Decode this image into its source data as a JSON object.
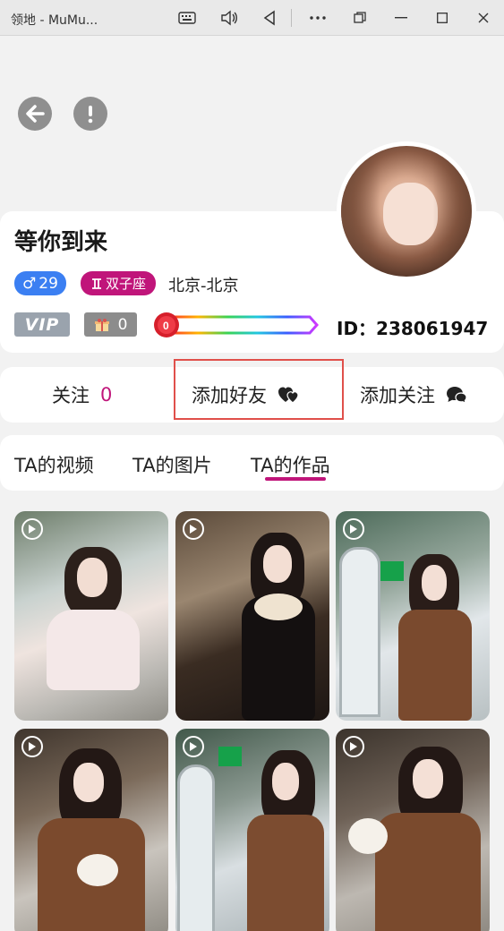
{
  "window": {
    "title": "领地 - MuMu..."
  },
  "profile": {
    "nickname": "等你到来",
    "gender_symbol": "♂",
    "age": "29",
    "zodiac": "双子座",
    "location": "北京-北京",
    "vip_label": "VIP",
    "gift_count": "0",
    "level_value": "0",
    "id_text": "ID：238061947"
  },
  "actions": {
    "follow_label": "关注",
    "follow_count": "0",
    "add_friend_label": "添加好友",
    "add_follow_label": "添加关注"
  },
  "tabs": [
    {
      "label": "TA的视频"
    },
    {
      "label": "TA的图片"
    },
    {
      "label": "TA的作品"
    }
  ],
  "active_tab": "TA的作品",
  "colors": {
    "accent": "#c0157a",
    "gender_blue": "#3b7ff2",
    "highlight_red": "#e0504b"
  },
  "grid": [
    {
      "type": "video"
    },
    {
      "type": "video"
    },
    {
      "type": "video"
    },
    {
      "type": "video"
    },
    {
      "type": "video"
    },
    {
      "type": "video"
    }
  ]
}
